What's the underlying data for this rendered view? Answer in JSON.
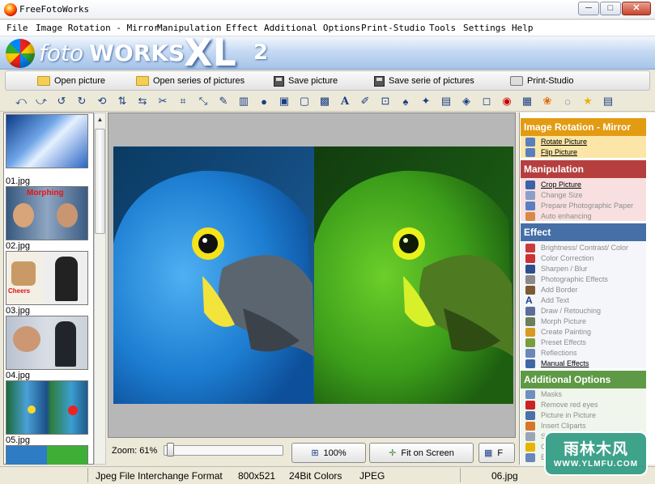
{
  "window": {
    "title": "FreeFotoWorks"
  },
  "menu": [
    "File",
    "Image Rotation - Mirror",
    "Manipulation",
    "Effect",
    "Additional Options",
    "Print-Studio",
    "Tools",
    "Settings",
    "Help"
  ],
  "logo": {
    "foto": "foto",
    "works": "WORKS",
    "xl": "XL",
    "version": "2"
  },
  "commands": {
    "open": "Open picture",
    "open_series": "Open series of pictures",
    "save": "Save picture",
    "save_series": "Save serie of pictures",
    "print": "Print-Studio"
  },
  "thumbnails": [
    "01.jpg",
    "02.jpg",
    "03.jpg",
    "04.jpg",
    "05.jpg"
  ],
  "thumb_overlay": {
    "morphing": "Morphing",
    "cheers": "Cheers"
  },
  "zoom": {
    "label": "Zoom: 61%",
    "level_percent": 61,
    "btn_100": "100%",
    "btn_fit": "Fit on Screen",
    "btn_f": "F"
  },
  "panel": {
    "rotation": {
      "title": "Image Rotation - Mirror",
      "color": "#e39b12",
      "items": [
        "Rotate Picture",
        "Flip Picture"
      ]
    },
    "manipulation": {
      "title": "Manipulation",
      "color": "#b53f3f",
      "items": [
        "Crop Picture",
        "Change Size",
        "Prepare Photographic Paper",
        "Auto enhancing"
      ]
    },
    "effect": {
      "title": "Effect",
      "color": "#456fa6",
      "items": [
        "Brightness/ Contrast/ Color",
        "Color Correction",
        "Sharpen / Blur",
        "Photographic Effects",
        "Add Border",
        "Add Text",
        "Draw / Retouching",
        "Morph Picture",
        "Create Painting",
        "Preset Effects",
        "Reflections",
        "Manual Effects"
      ]
    },
    "additional": {
      "title": "Additional Options",
      "color": "#5e9a45",
      "items": [
        "Masks",
        "Remove red eyes",
        "Picture in Picture",
        "Insert Cliparts",
        "S",
        "C",
        "E"
      ]
    }
  },
  "status": {
    "format": "Jpeg File Interchange Format",
    "dims": "800x521",
    "colors": "24Bit Colors",
    "type": "JPEG",
    "file": "06.jpg"
  },
  "watermark": {
    "main": "雨林木风",
    "url": "WWW.YLMFU.COM"
  }
}
